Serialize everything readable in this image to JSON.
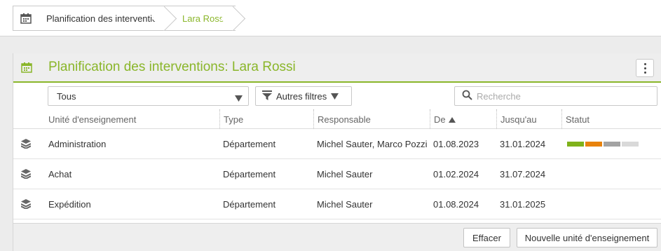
{
  "breadcrumb": {
    "items": [
      {
        "label": "Planification des interventions"
      },
      {
        "label": "Lara Rossi"
      }
    ]
  },
  "panel": {
    "title": "Planification des interventions: Lara Rossi"
  },
  "filters": {
    "select_value": "Tous",
    "more_filters_label": "Autres filtres",
    "search_placeholder": "Recherche"
  },
  "table": {
    "columns": {
      "unit": "Unité d'enseignement",
      "type": "Type",
      "responsible": "Responsable",
      "from": "De",
      "to": "Jusqu'au",
      "status": "Statut"
    },
    "rows": [
      {
        "unit": "Administration",
        "type": "Département",
        "responsible": "Michel Sauter, Marco Pozzi",
        "from": "01.08.2023",
        "to": "31.01.2024",
        "status": true
      },
      {
        "unit": "Achat",
        "type": "Département",
        "responsible": "Michel Sauter",
        "from": "01.02.2024",
        "to": "31.07.2024",
        "status": false
      },
      {
        "unit": "Expédition",
        "type": "Département",
        "responsible": "Michel Sauter",
        "from": "01.08.2024",
        "to": "31.01.2025",
        "status": false
      }
    ],
    "status_colors": [
      "#7fb21b",
      "#e8820c",
      "#a3a3a3",
      "#d9d9d9"
    ]
  },
  "footer": {
    "clear_label": "Effacer",
    "new_unit_label": "Nouvelle unité d'enseignement"
  },
  "colors": {
    "accent": "#8ab62a"
  }
}
